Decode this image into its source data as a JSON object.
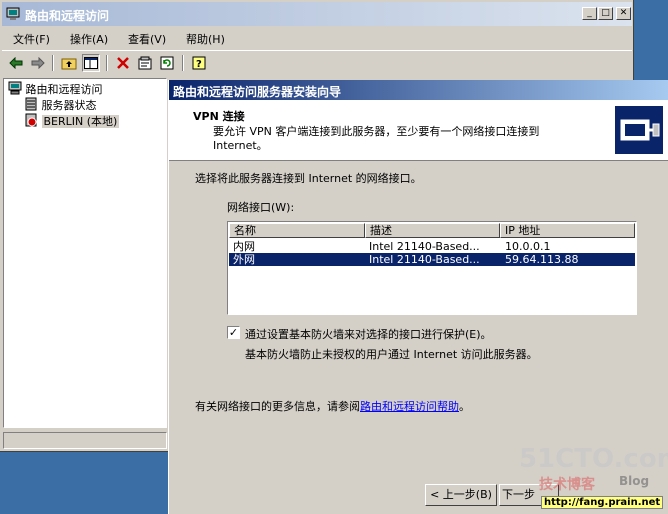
{
  "window": {
    "title": "路由和远程访问",
    "controls": {
      "minimize": "_",
      "maximize": "□",
      "close": "✕"
    }
  },
  "menu": {
    "items": [
      {
        "label": "文件(F)"
      },
      {
        "label": "操作(A)"
      },
      {
        "label": "查看(V)"
      },
      {
        "label": "帮助(H)"
      }
    ]
  },
  "toolbar": {
    "icons": [
      "back-arrow-icon",
      "forward-arrow-icon",
      "up-folder-icon",
      "show-hide-tree-icon",
      "delete-icon",
      "properties-icon",
      "refresh-icon",
      "help-icon"
    ]
  },
  "tree": {
    "root": "路由和远程访问",
    "server_status": "服务器状态",
    "server": "BERLIN (本地)"
  },
  "wizard": {
    "title": "路由和远程访问服务器安装向导",
    "header_title": "VPN 连接",
    "header_desc": "要允许 VPN 客户端连接到此服务器，至少要有一个网络接口连接到 Internet。",
    "instruction": "选择将此服务器连接到 Internet 的网络接口。",
    "list_label": "网络接口(W):",
    "columns": [
      "名称",
      "描述",
      "IP 地址"
    ],
    "rows": [
      {
        "name": "内网",
        "desc": "Intel 21140-Based...",
        "ip": "10.0.0.1",
        "selected": false
      },
      {
        "name": "外网",
        "desc": "Intel 21140-Based...",
        "ip": "59.64.113.88",
        "selected": true
      }
    ],
    "firewall_checkbox": "通过设置基本防火墙来对选择的接口进行保护(E)。",
    "firewall_checked": true,
    "firewall_note": "基本防火墙防止未授权的用户通过 Internet 访问此服务器。",
    "more_info_prefix": "有关网络接口的更多信息，请参阅",
    "more_info_link": "路由和远程访问帮助",
    "more_info_suffix": "。",
    "back_button": "< 上一步(B)",
    "next_button": "下一步"
  },
  "watermark": {
    "text1": "51CTO.com",
    "text2": "技术博客",
    "text3": "Blog",
    "url": "http://fang.prain.net"
  },
  "colors": {
    "selection": "#0a246a",
    "face": "#d4d0c8",
    "desktop": "#3a6ea5",
    "link": "#0000ff"
  }
}
